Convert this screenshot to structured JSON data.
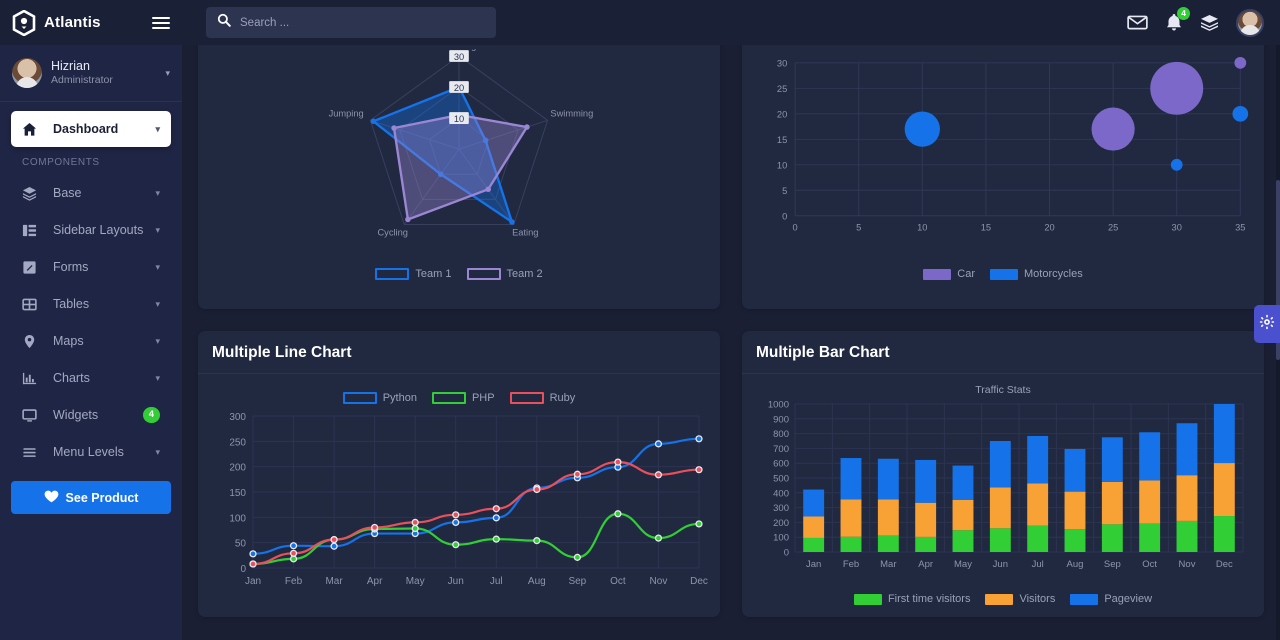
{
  "brand": {
    "name": "Atlantis",
    "logo_icon": "hexagon-logo-icon",
    "menu_icon": "hamburger-menu-icon"
  },
  "user": {
    "name": "Hizrian",
    "role": "Administrator",
    "caret": "▾"
  },
  "search": {
    "placeholder": "Search ...",
    "icon": "search-icon"
  },
  "topbar": {
    "mail_icon": "envelope-icon",
    "bell_icon": "bell-icon",
    "bell_badge": "4",
    "layers_icon": "layers-icon",
    "avatar": "user-avatar"
  },
  "sidebar": {
    "section_label": "COMPONENTS",
    "active_item": {
      "label": "Dashboard",
      "icon": "home-icon",
      "caret": "▾"
    },
    "items": [
      {
        "label": "Base",
        "icon": "layers-icon",
        "caret": "▾",
        "badge": null
      },
      {
        "label": "Sidebar Layouts",
        "icon": "sidebar-layout-icon",
        "caret": "▾",
        "badge": null
      },
      {
        "label": "Forms",
        "icon": "pencil-square-icon",
        "caret": "▾",
        "badge": null
      },
      {
        "label": "Tables",
        "icon": "table-grid-icon",
        "caret": "▾",
        "badge": null
      },
      {
        "label": "Maps",
        "icon": "map-pin-icon",
        "caret": "▾",
        "badge": null
      },
      {
        "label": "Charts",
        "icon": "bar-chart-icon",
        "caret": "▾",
        "badge": null
      },
      {
        "label": "Widgets",
        "icon": "monitor-icon",
        "caret": null,
        "badge": "4"
      },
      {
        "label": "Menu Levels",
        "icon": "menu-lines-icon",
        "caret": "▾",
        "badge": null
      }
    ],
    "cta": {
      "label": "See Product",
      "icon": "heart-icon"
    }
  },
  "settings_tab": {
    "icon": "gear-icon",
    "color": "#4b50cf"
  },
  "colors": {
    "blue": "#1572e8",
    "green": "#31ce36",
    "red": "#e9505c",
    "orange": "#f8a236",
    "purple": "#7b68c8",
    "card_bg": "#202940",
    "page_bg": "#1a1f33",
    "sidebar_bg": "#1f2544"
  },
  "cards": {
    "radar": {
      "title": ""
    },
    "bubble": {
      "title": ""
    },
    "line": {
      "title": "Multiple Line Chart"
    },
    "bar": {
      "title": "Multiple Bar Chart"
    }
  },
  "chart_data": [
    {
      "id": "radar-chart",
      "type": "radar",
      "title": "",
      "categories": [
        "Running",
        "Swimming",
        "Eating",
        "Cycling",
        "Jumping"
      ],
      "tick_labels": [
        "30",
        "20",
        "10"
      ],
      "rmax": 30,
      "legend_position": "bottom",
      "series": [
        {
          "name": "Team 1",
          "color": "#1572e8",
          "values": [
            20,
            9,
            29,
            10,
            29
          ]
        },
        {
          "name": "Team 2",
          "color": "#9b86d4",
          "values": [
            11,
            23,
            16,
            28,
            22
          ]
        }
      ]
    },
    {
      "id": "bubble-chart",
      "type": "scatter",
      "title": "",
      "xlabel": "",
      "ylabel": "",
      "xlim": [
        0,
        35
      ],
      "ylim": [
        0,
        30
      ],
      "xticks": [
        0,
        5,
        10,
        15,
        20,
        25,
        30,
        35
      ],
      "yticks": [
        0,
        5,
        10,
        15,
        20,
        25,
        30
      ],
      "grid": true,
      "legend_position": "bottom",
      "series": [
        {
          "name": "Car",
          "color": "#7b68c8",
          "points": [
            {
              "x": 25,
              "y": 17,
              "r": 22
            },
            {
              "x": 30,
              "y": 25,
              "r": 27
            },
            {
              "x": 35,
              "y": 30,
              "r": 6
            }
          ]
        },
        {
          "name": "Motorcycles",
          "color": "#1572e8",
          "points": [
            {
              "x": 10,
              "y": 17,
              "r": 18
            },
            {
              "x": 30,
              "y": 10,
              "r": 6
            },
            {
              "x": 35,
              "y": 20,
              "r": 8
            }
          ]
        }
      ]
    },
    {
      "id": "multiple-line-chart",
      "type": "line",
      "title": "Multiple Line Chart",
      "xlabel": "",
      "ylabel": "",
      "categories": [
        "Jan",
        "Feb",
        "Mar",
        "Apr",
        "May",
        "Jun",
        "Jul",
        "Aug",
        "Sep",
        "Oct",
        "Nov",
        "Dec"
      ],
      "ylim": [
        0,
        300
      ],
      "yticks": [
        0,
        50,
        100,
        150,
        200,
        250,
        300
      ],
      "grid": true,
      "legend_position": "top",
      "series": [
        {
          "name": "Python",
          "color": "#1572e8",
          "values": [
            28,
            44,
            43,
            68,
            68,
            90,
            99,
            158,
            178,
            199,
            245,
            255
          ]
        },
        {
          "name": "PHP",
          "color": "#31ce36",
          "values": [
            8,
            18,
            56,
            77,
            78,
            46,
            57,
            54,
            21,
            107,
            59,
            87
          ]
        },
        {
          "name": "Ruby",
          "color": "#e9505c",
          "values": [
            8,
            29,
            56,
            80,
            90,
            105,
            117,
            155,
            185,
            209,
            184,
            194
          ]
        }
      ]
    },
    {
      "id": "multiple-bar-chart",
      "type": "bar",
      "title": "Multiple Bar Chart",
      "subtitle": "Traffic Stats",
      "stacked": true,
      "categories": [
        "Jan",
        "Feb",
        "Mar",
        "Apr",
        "May",
        "Jun",
        "Jul",
        "Aug",
        "Sep",
        "Oct",
        "Nov",
        "Dec"
      ],
      "ylim": [
        0,
        1000
      ],
      "yticks": [
        0,
        100,
        200,
        300,
        400,
        500,
        600,
        700,
        800,
        900,
        1000
      ],
      "grid": true,
      "legend_position": "bottom",
      "series": [
        {
          "name": "First time visitors",
          "color": "#31ce36",
          "values": [
            95,
            103,
            112,
            102,
            147,
            160,
            178,
            155,
            187,
            193,
            210,
            243
          ]
        },
        {
          "name": "Visitors",
          "color": "#f8a236",
          "values": [
            145,
            252,
            243,
            231,
            206,
            277,
            286,
            253,
            287,
            291,
            309,
            358
          ]
        },
        {
          "name": "Pageview",
          "color": "#1572e8",
          "values": [
            182,
            280,
            275,
            289,
            231,
            313,
            320,
            288,
            301,
            325,
            351,
            399
          ]
        }
      ]
    }
  ]
}
